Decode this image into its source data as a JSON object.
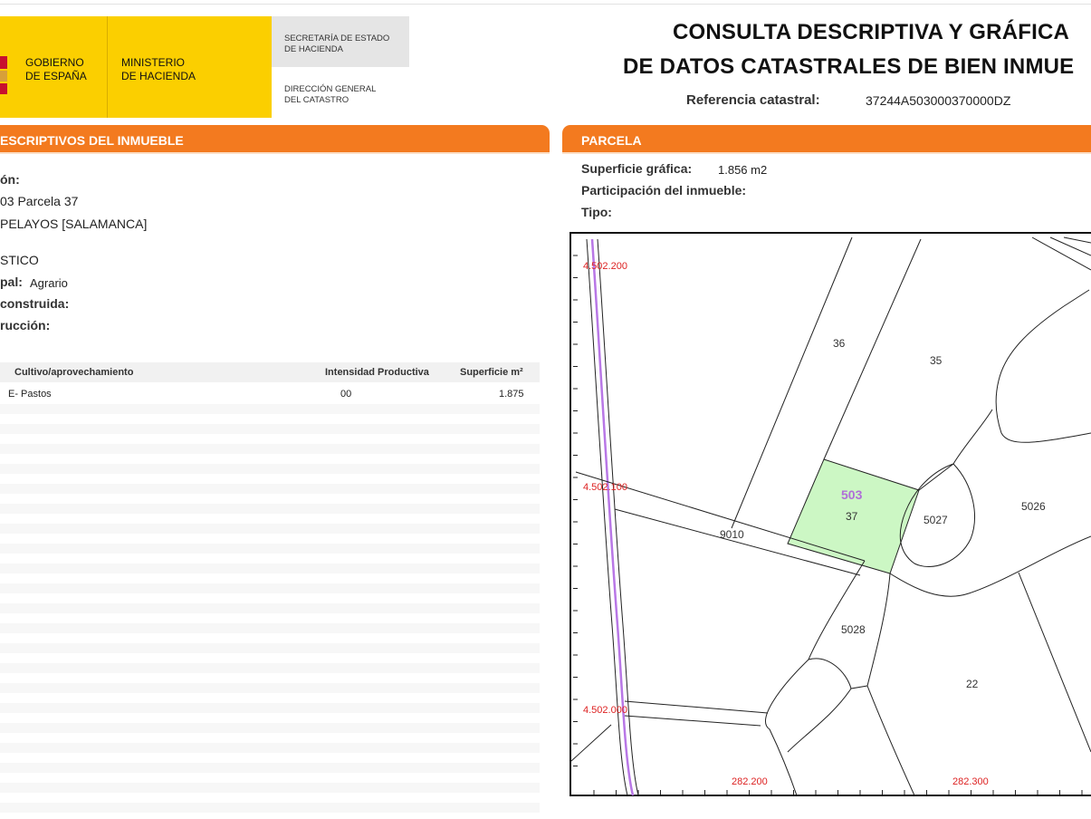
{
  "header": {
    "gobierno": [
      "GOBIERNO",
      "DE ESPAÑA"
    ],
    "ministerio": [
      "MINISTERIO",
      "DE HACIENDA"
    ],
    "secretaria": [
      "SECRETARÍA DE ESTADO",
      "DE HACIENDA"
    ],
    "direccion": [
      "DIRECCIÓN GENERAL",
      "DEL CATASTRO"
    ],
    "title_line1": "CONSULTA DESCRIPTIVA Y GRÁFICA",
    "title_line2": "DE DATOS CATASTRALES DE BIEN INMUE",
    "ref_label": "Referencia catastral:",
    "ref_value": "37244A503000370000DZ"
  },
  "left": {
    "section_title": "ESCRIPTIVOS DEL INMUEBLE",
    "loc_label": "ón:",
    "loc_line1": "03 Parcela 37",
    "loc_line2": "PELAYOS [SALAMANCA]",
    "clase": "STICO",
    "uso_label": "pal:",
    "uso_value": "Agrario",
    "sup_label": "construida:",
    "anio_label": "rucción:",
    "table": {
      "headers": [
        "Cultivo/aprovechamiento",
        "Intensidad Productiva",
        "Superficie m²"
      ],
      "rows": [
        [
          "E- Pastos",
          "00",
          "1.875"
        ]
      ]
    }
  },
  "right": {
    "section_title": "PARCELA",
    "sup_grafica_label": "Superficie gráfica:",
    "sup_grafica_value": "1.856 m2",
    "participacion_label": "Participación del inmueble:",
    "tipo_label": "Tipo:"
  },
  "map": {
    "y_ticks": [
      "4.502.200",
      "4.502.100",
      "4.502.000"
    ],
    "x_ticks": [
      "282.200",
      "282.300"
    ],
    "polygon_label": "503",
    "parcel_labels": [
      "36",
      "35",
      "37",
      "5027",
      "5026",
      "9010",
      "5028",
      "22"
    ],
    "colors": {
      "highlight": "#ccf7c4",
      "coords": "#dd2222",
      "road": "#b877e6",
      "poly_label": "#b06ed8"
    }
  }
}
